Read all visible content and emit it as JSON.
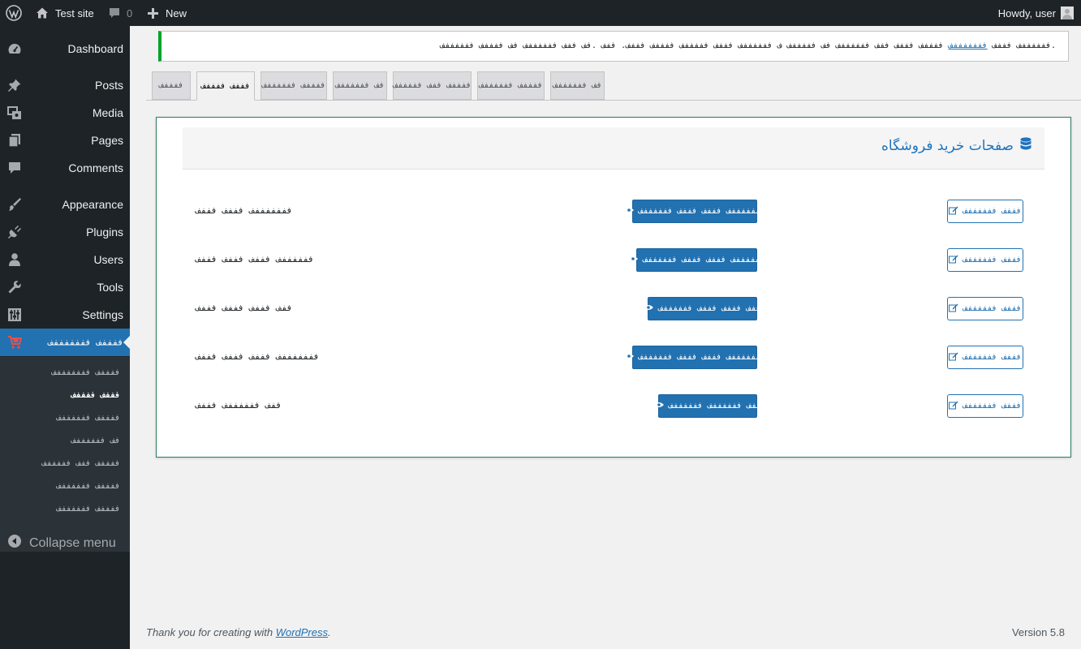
{
  "admin_bar": {
    "site_name": "Test site",
    "comments_count": "0",
    "new_label": "New",
    "howdy": "Howdy, user"
  },
  "sidebar": {
    "items": [
      {
        "label": "Dashboard",
        "icon": "dashboard-icon"
      },
      {
        "label": "Posts",
        "icon": "pin-icon"
      },
      {
        "label": "Media",
        "icon": "media-icon"
      },
      {
        "label": "Pages",
        "icon": "pages-icon"
      },
      {
        "label": "Comments",
        "icon": "comment-icon"
      },
      {
        "label": "Appearance",
        "icon": "brush-icon"
      },
      {
        "label": "Plugins",
        "icon": "plugin-icon"
      },
      {
        "label": "Users",
        "icon": "user-icon"
      },
      {
        "label": "Tools",
        "icon": "wrench-icon"
      },
      {
        "label": "Settings",
        "icon": "settings-icon"
      },
      {
        "label": "ففففف فففففففف",
        "icon": "cart-icon"
      }
    ],
    "submenu": [
      "ففففف فففففففف",
      "فففف ففففف",
      "ففففف ففففففف",
      "فف ففففففف",
      "ففففف ففف فففففف",
      "ففففف ففففففف",
      "ففففف ففففففف"
    ],
    "collapse_label": "Collapse menu"
  },
  "notice": {
    "text_before": "ففففففف فففف",
    "link": "فففففففف",
    "text_after": "ففففف فففف ففف ففففففف فف فففففف ف ففففففف فففف فففففف ففففف فففف. ففف .فف ففف ففففففف فف ففففف ففففففف."
  },
  "tabs": [
    "ففففف",
    "فففف ففففف",
    "ففففف ففففففف",
    "فف ففففففف",
    "ففففف ففف فففففف",
    "ففففف ففففففف",
    "فف ففففففف"
  ],
  "panel": {
    "title": "صفحات خرید فروشگاه",
    "rows": [
      {
        "label": "فففففففف فففف فففف",
        "view": "فففففففف فففف فففف ففففففف",
        "edit": "فففف ففففففف"
      },
      {
        "label": "ففففففف فففف فففف فففف",
        "view": "ففففففف فففف فففف ففففففف",
        "edit": "فففف ففففففف"
      },
      {
        "label": "ففف فففف فففف فففف",
        "view": "ففف فففف فففف ففففففف",
        "edit": "فففف ففففففف"
      },
      {
        "label": "فففففففف فففف فففف فففف",
        "view": "فففففففف فففف فففف ففففففف",
        "edit": "فففف ففففففف"
      },
      {
        "label": "ففف ففففففف فففف",
        "view": "ففف ففففففف ففففففف",
        "edit": "فففف ففففففف"
      }
    ]
  },
  "footer": {
    "thanks_before": "Thank you for creating with ",
    "thanks_link": "WordPress",
    "thanks_after": ".",
    "version": "Version 5.8"
  },
  "colors": {
    "admin_bg": "#1d2327",
    "accent": "#2271b1",
    "notice_success": "#00a32a",
    "panel_title": "#1e73be"
  }
}
